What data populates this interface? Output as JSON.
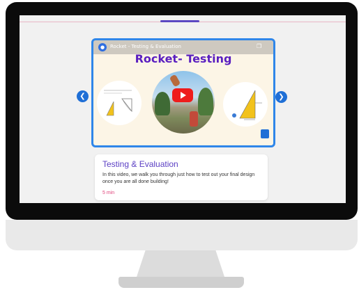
{
  "video": {
    "channel_title": "Rocket - Testing & Evaluation",
    "title": "Rocket- Testing",
    "colors": {
      "border": "#2f86e9",
      "title": "#5a1fc0",
      "play": "#ee1c1c"
    },
    "icons": [
      "channel-avatar-icon",
      "copy-link-icon",
      "play-icon",
      "logo-icon"
    ]
  },
  "carousel": {
    "prev_icon": "chevron-left-icon",
    "next_icon": "chevron-right-icon",
    "accent": "#1f6fd6"
  },
  "card": {
    "title": "Testing & Evaluation",
    "description": "In this video, we walk you through just how to test out your final design once you are all done building!",
    "duration": "5 min",
    "colors": {
      "title": "#5b3fc4",
      "duration": "#e0427a"
    }
  }
}
